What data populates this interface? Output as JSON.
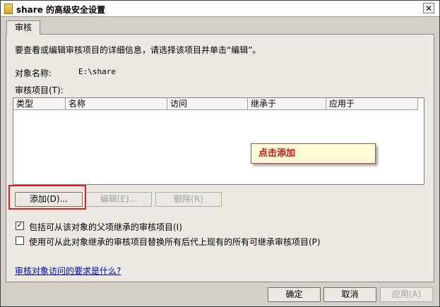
{
  "window": {
    "title": "share 的高级安全设置",
    "close_glyph": "✕"
  },
  "tab": {
    "label": "审核"
  },
  "panel": {
    "intro": "要查看或编辑审核项目的详细信息，请选择该项目并单击“编辑”。",
    "object_name_label": "对象名称:",
    "object_name_value": "E:\\share",
    "audit_entries_label": "审核项目(T):"
  },
  "table": {
    "columns": [
      "类型",
      "名称",
      "访问",
      "继承于",
      "应用于"
    ]
  },
  "buttons": {
    "add": "添加(D)...",
    "edit": "编辑(E)...",
    "remove": "删除(R)",
    "ok": "确定",
    "cancel": "取消",
    "apply": "应用(A)"
  },
  "checkboxes": {
    "include_inheritable": {
      "label": "包括可从该对象的父项继承的审核项目(I)",
      "checked": true
    },
    "replace_child": {
      "label": "使用可从此对象继承的审核项目替换所有后代上现有的所有可继承审核项目(P)",
      "checked": false
    }
  },
  "link": {
    "text": "审核对象访问的要求是什么?"
  },
  "annotation": {
    "callout_text": "点击添加",
    "color": "#d01010"
  }
}
